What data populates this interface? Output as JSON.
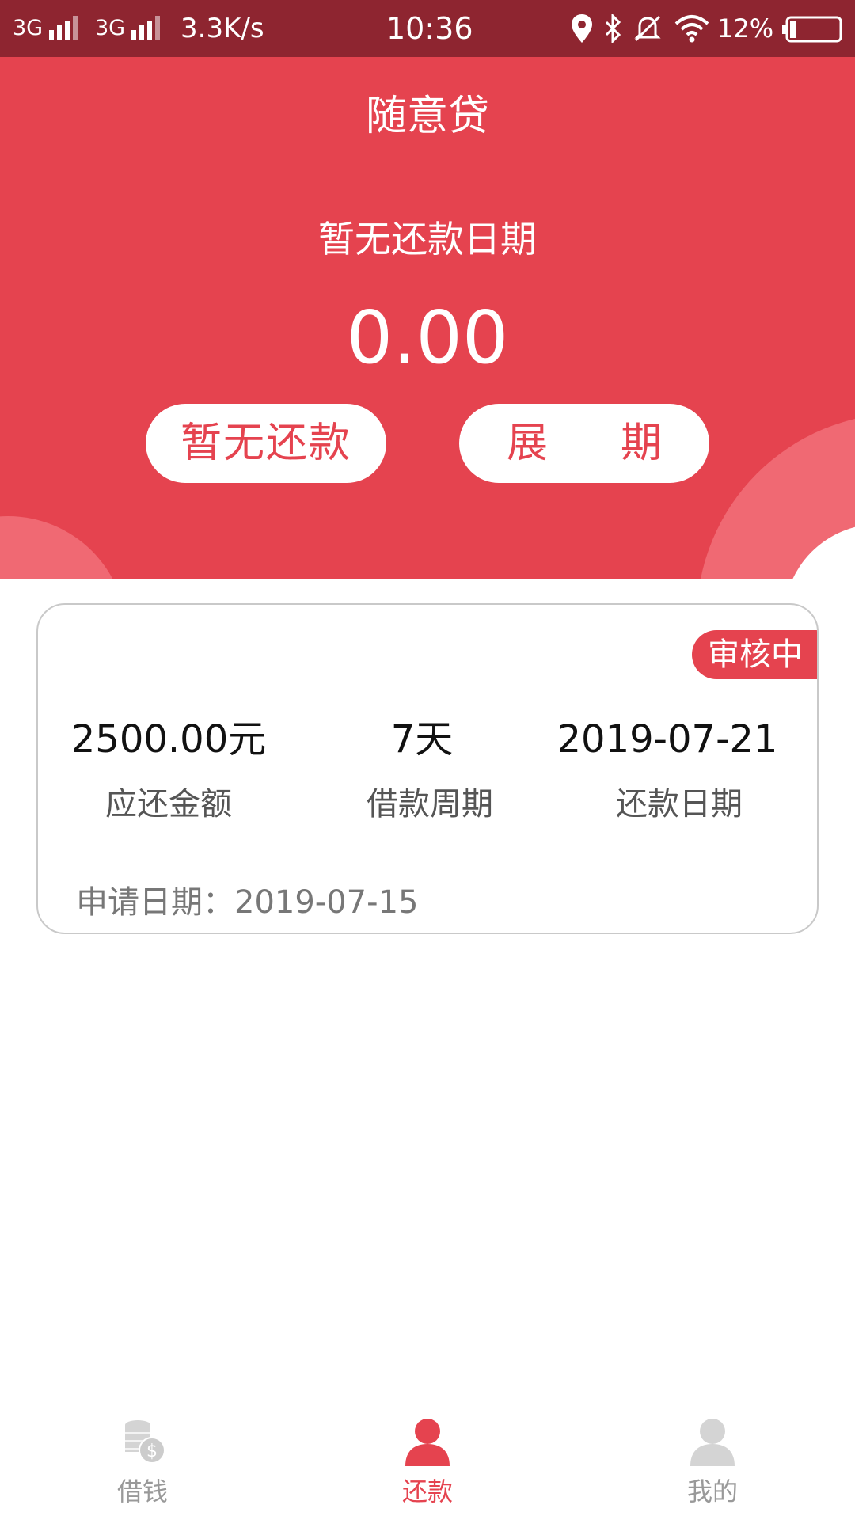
{
  "status_bar": {
    "net1": "3G",
    "net2": "3G",
    "speed": "3.3K/s",
    "time": "10:36",
    "battery": "12%"
  },
  "header": {
    "title": "随意贷",
    "due_text": "暂无还款日期",
    "amount": "0.00",
    "repay_button": "暂无还款",
    "extend_button_left": "展",
    "extend_button_right": "期"
  },
  "loan_card": {
    "status_badge": "审核中",
    "amount_value": "2500.00元",
    "amount_label": "应还金额",
    "period_value": "7天",
    "period_label": "借款周期",
    "due_value": "2019-07-21",
    "due_label": "还款日期",
    "apply_label": "申请日期：",
    "apply_date": "2019-07-15"
  },
  "tabs": [
    {
      "label": "借钱",
      "icon": "coins-icon",
      "active": false
    },
    {
      "label": "还款",
      "icon": "person-icon",
      "active": true
    },
    {
      "label": "我的",
      "icon": "user-icon",
      "active": false
    }
  ],
  "colors": {
    "primary": "#e5434f",
    "status_bar": "#8e2530",
    "decor": "#f06973",
    "inactive_tab": "#cccccc"
  }
}
